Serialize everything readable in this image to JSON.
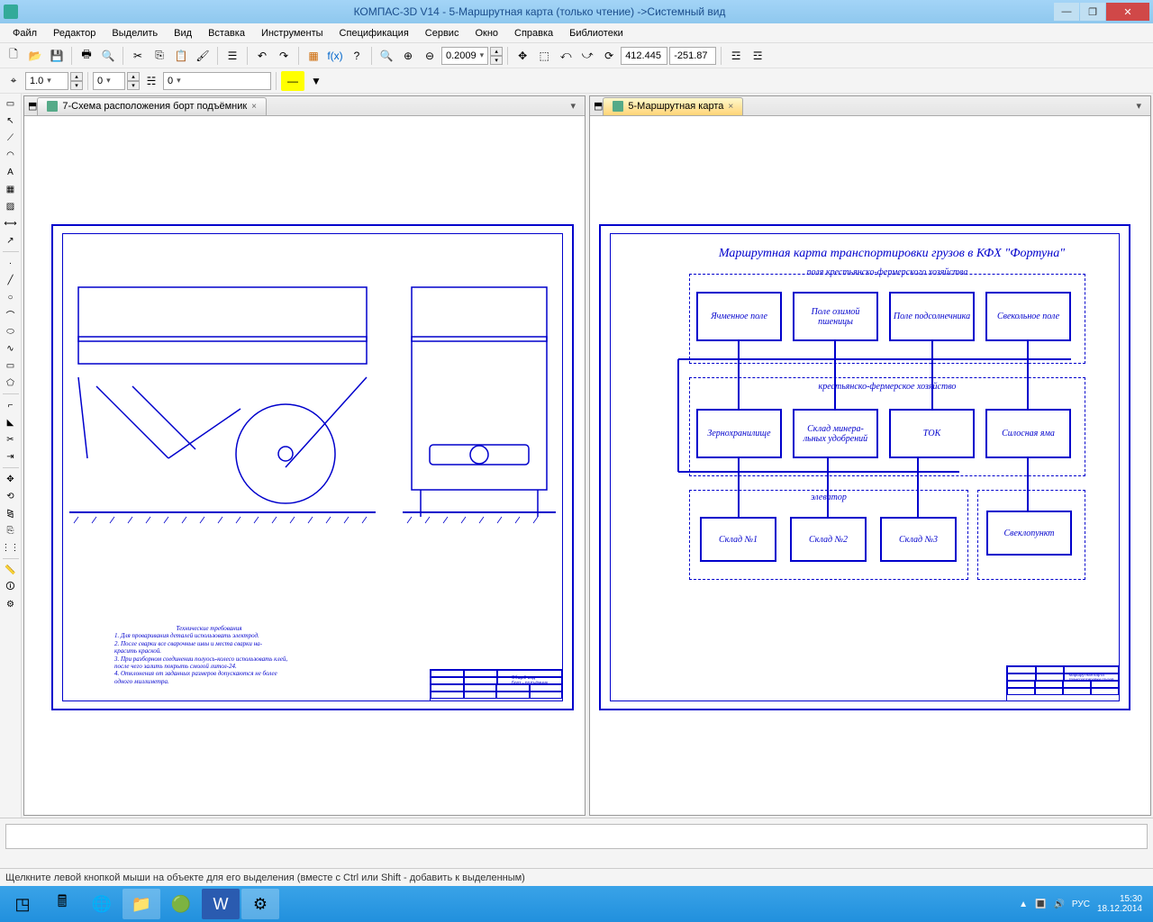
{
  "window": {
    "title": "КОМПАС-3D V14 - 5-Маршрутная карта (только чтение) ->Системный вид",
    "min": "—",
    "max": "❐",
    "close": "✕"
  },
  "menu": [
    "Файл",
    "Редактор",
    "Выделить",
    "Вид",
    "Вставка",
    "Инструменты",
    "Спецификация",
    "Сервис",
    "Окно",
    "Справка",
    "Библиотеки"
  ],
  "toolbar2": {
    "scale": "1.0",
    "step": "0",
    "style": "0",
    "zoom": "0.2009",
    "coord_x": "412.445",
    "coord_y": "-251.87"
  },
  "tabs": {
    "left": "7-Схема расположения борт подъёмник",
    "right": "5-Маршрутная карта"
  },
  "left_drawing": {
    "tech_header": "Технические требования",
    "tech_lines": [
      "1. Для проваривания деталей использовать электрод.",
      "2. После сварки все сварочные швы и места сварки на-",
      "красить краской.",
      "3. При разборном соединении полуось-колесо использовать клей,",
      "после чего залить покрыть смолой литол-24.",
      "4. Отклонения от заданных размеров допускаются не более",
      "одного миллиметра."
    ],
    "title_block": "Общий вид\nборт - подъёмник"
  },
  "right_drawing": {
    "title": "Маршрутная карта транспортировки грузов в КФХ \"Фортуна\"",
    "group_fields": "поля крестьянско-фермерского хозяйства",
    "group_farm": "крестьянско-фермерское хозяйство",
    "group_elevator": "элеватор",
    "boxes": {
      "barley": "Ячменное поле",
      "wheat": "Поле озимой пшеницы",
      "sunflower": "Поле подсолнечника",
      "beet": "Свекольное поле",
      "granary": "Зернохранилище",
      "fert": "Склад минера-\nльных удобрений",
      "tok": "ТОК",
      "silo": "Силосная яма",
      "w1": "Склад №1",
      "w2": "Склад №2",
      "w3": "Склад №3",
      "beetpoint": "Свеклопункт"
    },
    "title_block": "Маршрутная карта\nтранспортировки грузов"
  },
  "statusbar": "Щелкните левой кнопкой мыши на объекте для его выделения (вместе с Ctrl или Shift - добавить к выделенным)",
  "taskbar": {
    "lang": "РУС",
    "time": "15:30",
    "date": "18.12.2014"
  }
}
